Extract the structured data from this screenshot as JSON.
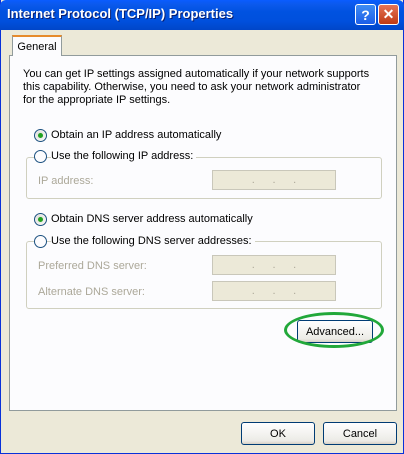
{
  "window": {
    "title": "Internet Protocol (TCP/IP) Properties",
    "help_label": "?",
    "close_label": "✕"
  },
  "tabs": [
    {
      "label": "General"
    }
  ],
  "description": "You can get IP settings assigned automatically if your network supports this capability. Otherwise, you need to ask your network administrator for the appropriate IP settings.",
  "ip": {
    "auto_label": "Obtain an IP address automatically",
    "auto_selected": true,
    "manual_label": "Use the following IP address:",
    "address_label": "IP address:",
    "address_dots": [
      ".",
      ".",
      "."
    ]
  },
  "dns": {
    "auto_label": "Obtain DNS server address automatically",
    "auto_selected": true,
    "manual_label": "Use the following DNS server addresses:",
    "preferred_label": "Preferred DNS server:",
    "alternate_label": "Alternate DNS server:",
    "field_dots": [
      ".",
      ".",
      "."
    ]
  },
  "buttons": {
    "advanced": "Advanced...",
    "ok": "OK",
    "cancel": "Cancel"
  },
  "colors": {
    "titlebar": "#0054e3",
    "radio_dot": "#21a121",
    "highlight_ring": "#22a83a"
  }
}
